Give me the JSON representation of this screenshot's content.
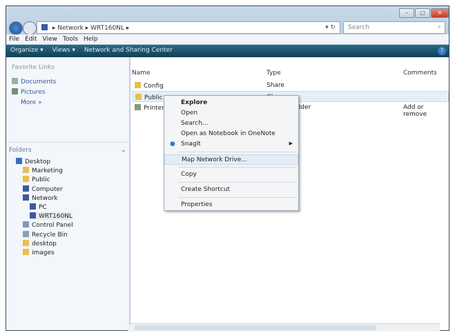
{
  "window": {
    "minimize": "–",
    "maximize": "□",
    "close": "✕"
  },
  "address": {
    "path": [
      "Network",
      "WRT160NL"
    ],
    "search_placeholder": "Search"
  },
  "menu": [
    "File",
    "Edit",
    "View",
    "Tools",
    "Help"
  ],
  "toolbar": {
    "organize": "Organize ▾",
    "views": "Views ▾",
    "network_center": "Network and Sharing Center",
    "help": "?"
  },
  "favorites": {
    "title": "Favorite Links",
    "items": [
      "Documents",
      "Pictures"
    ],
    "more": "More »"
  },
  "folders": {
    "title": "Folders",
    "items": [
      {
        "label": "Desktop",
        "indent": 0,
        "icon": "desktop-icon"
      },
      {
        "label": "Marketing",
        "indent": 1,
        "icon": "folder-icon"
      },
      {
        "label": "Public",
        "indent": 1,
        "icon": "folder-icon"
      },
      {
        "label": "Computer",
        "indent": 1,
        "icon": "computer-icon"
      },
      {
        "label": "Network",
        "indent": 1,
        "icon": "network-icon"
      },
      {
        "label": "PC",
        "indent": 2,
        "icon": "computer-icon"
      },
      {
        "label": "WRT160NL",
        "indent": 2,
        "icon": "computer-icon"
      },
      {
        "label": "Control Panel",
        "indent": 1,
        "icon": "control-panel-icon"
      },
      {
        "label": "Recycle Bin",
        "indent": 1,
        "icon": "recycle-bin-icon"
      },
      {
        "label": "desktop",
        "indent": 1,
        "icon": "folder-icon"
      },
      {
        "label": "images",
        "indent": 1,
        "icon": "folder-icon"
      }
    ]
  },
  "columns": {
    "name": "Name",
    "type": "Type",
    "comments": "Comments"
  },
  "files": [
    {
      "name": "Config",
      "type": "Share",
      "comments": ""
    },
    {
      "name": "Public",
      "type": "Share",
      "comments": ""
    },
    {
      "name": "Printers",
      "type": "System Folder",
      "comments": "Add or remove"
    }
  ],
  "context_menu": [
    "Explore",
    "Open",
    "Search...",
    "Open as Notebook in OneNote",
    "SnagIt",
    "Map Network Drive...",
    "Copy",
    "Create Shortcut",
    "Properties"
  ]
}
